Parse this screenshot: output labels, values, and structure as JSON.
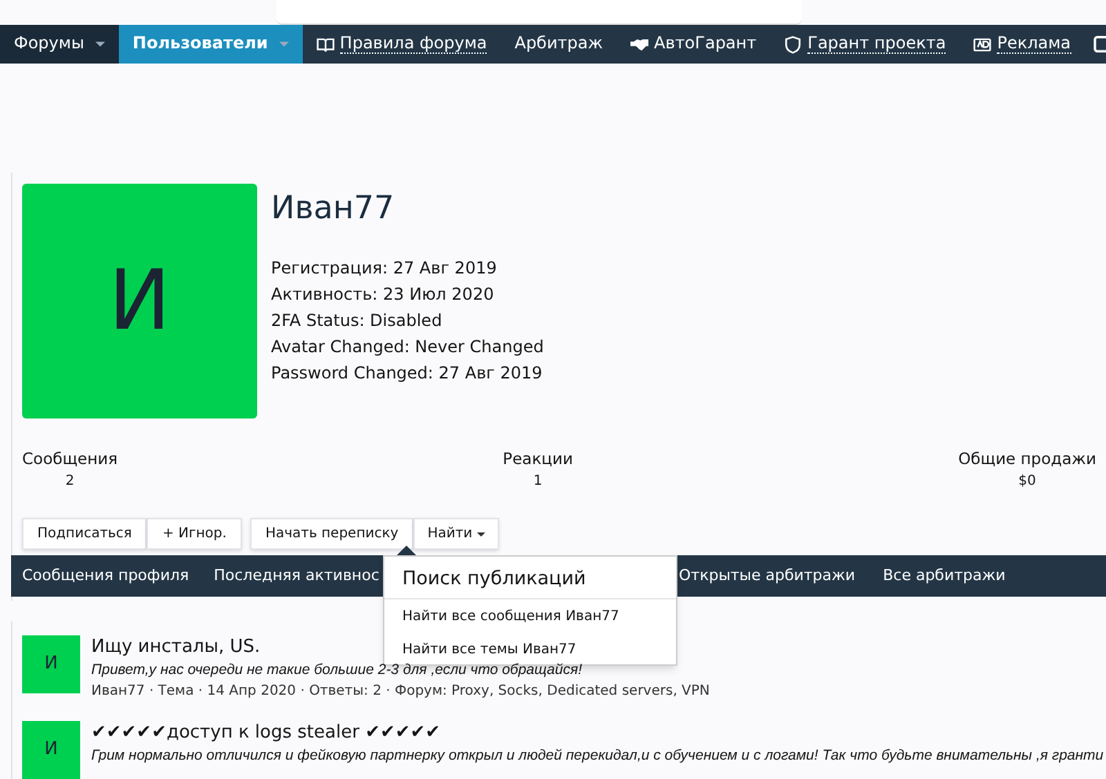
{
  "nav": {
    "items": [
      {
        "label": "Форумы",
        "selected": false,
        "kind": "menu",
        "dotted": false
      },
      {
        "label": "Пользователи",
        "selected": true,
        "kind": "menu",
        "dotted": false
      },
      {
        "label": "Правила форума",
        "selected": false,
        "kind": "book",
        "dotted": true
      },
      {
        "label": "Арбитраж",
        "selected": false,
        "kind": "plain",
        "dotted": false
      },
      {
        "label": "АвтоГарант",
        "selected": false,
        "kind": "handshake",
        "dotted": false
      },
      {
        "label": "Гарант проекта",
        "selected": false,
        "kind": "shield",
        "dotted": true
      },
      {
        "label": "Реклама",
        "selected": false,
        "kind": "ad",
        "dotted": true
      }
    ]
  },
  "profile": {
    "avatar_letter": "И",
    "username": "Иван77",
    "details": [
      "Регистрация: 27 Авг 2019",
      "Активность: 23 Июл 2020",
      "2FA Status: Disabled",
      "Avatar Changed: Never Changed",
      "Password Changed: 27 Авг 2019"
    ],
    "stats": [
      {
        "label": "Сообщения",
        "value": "2"
      },
      {
        "label": "Реакции",
        "value": "1"
      },
      {
        "label": "Общие продажи",
        "value": "$0"
      }
    ],
    "buttons": [
      "Подписаться",
      "+ Игнор.",
      "Начать переписку"
    ],
    "find_button": "Найти"
  },
  "tabs": [
    {
      "label": "Сообщения профиля",
      "selected": false
    },
    {
      "label": "Последняя активнос",
      "selected": false
    },
    {
      "label": "Открытые арбитражи",
      "selected": false
    },
    {
      "label": "Все арбитражи",
      "selected": false
    }
  ],
  "dropdown": {
    "title": "Поиск публикаций",
    "items": [
      "Найти все сообщения Иван77",
      "Найти все темы Иван77"
    ]
  },
  "posts": [
    {
      "avatar_letter": "И",
      "title": "Ищу инсталы, US.",
      "snippet": "Привет,у нас очереди не такие большие 2-3 для ,если что обращайся!",
      "meta": "Иван77 · Тема · 14 Апр 2020 · Ответы: 2 · Форум: Proxy, Socks, Dedicated servers, VPN"
    },
    {
      "avatar_letter": "И",
      "title": "✔✔✔✔✔доступ к logs stealer ✔✔✔✔✔",
      "snippet": "Грим нормально отличился и фейковую партнерку открыл и людей перекидал,и с обучением и с логами! Так что будьте внимательны ,я гранти"
    }
  ]
}
